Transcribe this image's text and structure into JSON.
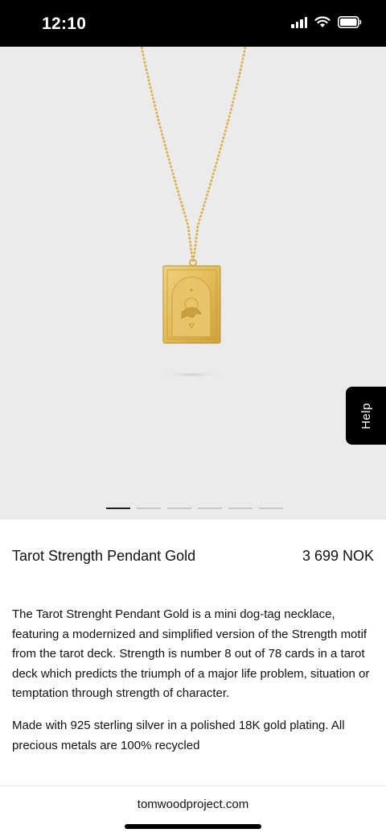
{
  "status_bar": {
    "time": "12:10"
  },
  "gallery": {
    "image_alt": "Tarot Strength Pendant Gold",
    "slide_count": 6,
    "active_slide": 1
  },
  "help_tab": {
    "label": "Help"
  },
  "product": {
    "title": "Tarot Strength Pendant Gold",
    "price": "3 699 NOK",
    "description": [
      "The Tarot Strenght Pendant Gold is a mini dog-tag necklace, featuring a modernized and simplified version of the Strength motif from the tarot deck. Strength is number 8 out of 78 cards in a tarot deck which predicts the triumph of a major life problem, situation or temptation through strength of character.",
      "Made with 925 sterling silver in a polished 18K gold plating. All precious metals are 100% recycled"
    ]
  },
  "browser": {
    "url": "tomwoodproject.com"
  },
  "colors": {
    "gallery_bg": "#ebebec",
    "gold": "#e0b84a",
    "dark": "#000000"
  }
}
